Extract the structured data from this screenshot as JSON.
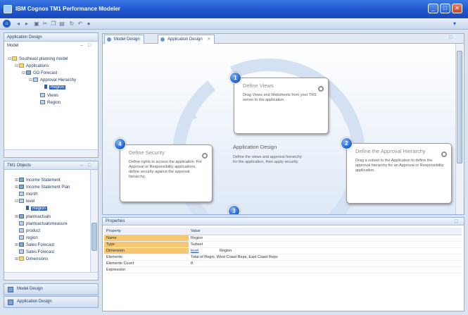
{
  "app": {
    "title": "IBM Cognos TM1 Performance Modeler"
  },
  "window_controls": [
    "_",
    "□",
    "✕"
  ],
  "toolbar": {
    "icons": [
      "home-icon",
      "back-icon",
      "forward-icon",
      "save-icon",
      "cut-icon",
      "copy-icon",
      "paste-icon",
      "refresh-icon",
      "undo-icon",
      "run-icon",
      "help-icon"
    ]
  },
  "left_pane": {
    "title": "Application Design",
    "tree_title": "Model",
    "tree": [
      {
        "label": "Southeast planning model",
        "depth": 0
      },
      {
        "label": "Applications",
        "depth": 1
      },
      {
        "label": "GO Forecast",
        "depth": 2
      },
      {
        "label": "Approval Hierarchy",
        "depth": 3
      },
      {
        "label": "Region",
        "depth": 4
      },
      {
        "label": "Views",
        "depth": 3
      },
      {
        "label": "Region",
        "depth": 3
      }
    ]
  },
  "tm1_objects": {
    "title": "TM1 Objects",
    "items": [
      {
        "label": "Income Statement",
        "depth": 0
      },
      {
        "label": "Income Statement Plan",
        "depth": 0
      },
      {
        "label": "month",
        "depth": 0
      },
      {
        "label": "level",
        "depth": 0
      },
      {
        "label": "Region",
        "depth": 1,
        "selected": true
      },
      {
        "label": "plantoactuals",
        "depth": 0
      },
      {
        "label": "plantoactualsmeasure",
        "depth": 0
      },
      {
        "label": "product",
        "depth": 0
      },
      {
        "label": "region",
        "depth": 0
      },
      {
        "label": "Sales Forecast",
        "depth": 0
      },
      {
        "label": "Sales Forecast",
        "depth": 0
      },
      {
        "label": "Dimensions",
        "depth": 0
      }
    ]
  },
  "nav_tabs": [
    {
      "label": "Model Design"
    },
    {
      "label": "Application Design"
    }
  ],
  "editor": {
    "tabs": [
      {
        "label": "Model Design"
      },
      {
        "label": "Application Design"
      }
    ],
    "center": {
      "title": "Application Design",
      "description": "Define the views and approval hierarchy for the application, then apply security."
    },
    "steps": [
      {
        "number": "1",
        "title": "Define Views",
        "description": "Drag Views and Websheets from your TM1 server to the application."
      },
      {
        "number": "2",
        "title": "Define the Approval Hierarchy",
        "description": "Drag a subset to the Application to define the approval hierarchy for an Approval or Responsibility application."
      },
      {
        "number": "3",
        "title": "",
        "description": ""
      },
      {
        "number": "4",
        "title": "Define Security",
        "description": "Define rights to access the application. For Approval or Responsibility applications, define security against the approval hierarchy."
      }
    ]
  },
  "properties": {
    "title": "Properties",
    "headers": [
      "Property",
      "Value"
    ],
    "rows": [
      {
        "name": "Name",
        "value": "Region",
        "highlight": true
      },
      {
        "name": "Type",
        "value": "Subset",
        "highlight": true
      },
      {
        "name": "Dimension",
        "value": "level",
        "value2": "Region",
        "highlight": true,
        "link": true
      },
      {
        "name": "Elements",
        "value": "Total of Regio, West Coast Reps, East Coast Reps",
        "highlight": false
      },
      {
        "name": "Elements Count",
        "value": "8",
        "highlight": false
      },
      {
        "name": "Expression",
        "value": "",
        "highlight": false
      }
    ]
  }
}
